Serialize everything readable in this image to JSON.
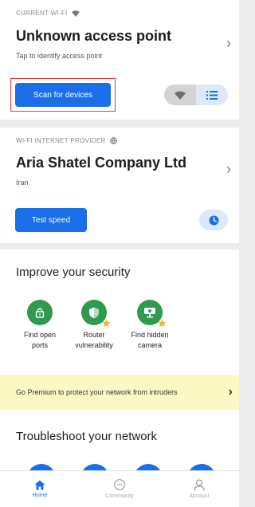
{
  "current_wifi": {
    "overline": "CURRENT WI-FI",
    "title": "Unknown access point",
    "subtitle": "Tap to identify access point",
    "scan_button": "Scan for devices"
  },
  "provider": {
    "overline": "WI-FI INTERNET PROVIDER",
    "title": "Aria Shatel Company Ltd",
    "subtitle": "Iran",
    "test_button": "Test speed"
  },
  "security": {
    "title": "Improve your security",
    "features": [
      {
        "line1": "Find open",
        "line2": "ports",
        "icon": "lock-icon"
      },
      {
        "line1": "Router",
        "line2": "vulnerability",
        "icon": "shield-icon"
      },
      {
        "line1": "Find hidden",
        "line2": "camera",
        "icon": "camera-icon"
      }
    ]
  },
  "premium_banner": "Go Premium to protect your network from intruders",
  "troubleshoot": {
    "title": "Troubleshoot your network"
  },
  "nav": {
    "items": [
      {
        "label": "Home",
        "icon": "home-icon",
        "active": true
      },
      {
        "label": "Community",
        "icon": "chat-icon",
        "active": false
      },
      {
        "label": "Account",
        "icon": "person-icon",
        "active": false
      }
    ]
  },
  "colors": {
    "accent": "#1a6ee8",
    "green": "#2e9a4e",
    "highlight_border": "#e53935",
    "premium_bg": "#fbf8c4",
    "star": "#f2b233"
  }
}
